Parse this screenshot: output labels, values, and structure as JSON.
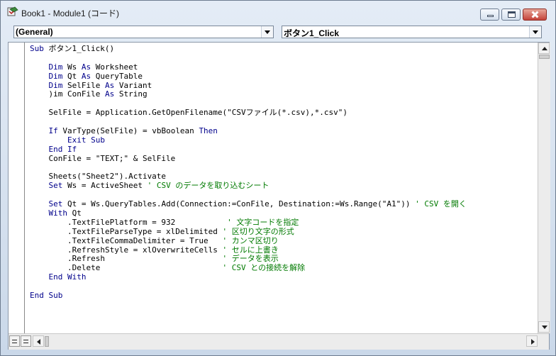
{
  "window": {
    "title": "Book1 - Module1 (コード)"
  },
  "combos": {
    "object_selected": "(General)",
    "procedure_selected": "ボタン1_Click"
  },
  "colors": {
    "keyword": "#00008b",
    "comment": "#007a00",
    "text": "#000000"
  },
  "code_lines": [
    [
      {
        "t": "kw",
        "v": "Sub"
      },
      {
        "t": "tx",
        "v": " ボタン1_Click()"
      }
    ],
    [],
    [
      {
        "t": "tx",
        "v": "    "
      },
      {
        "t": "kw",
        "v": "Dim"
      },
      {
        "t": "tx",
        "v": " Ws "
      },
      {
        "t": "kw",
        "v": "As"
      },
      {
        "t": "tx",
        "v": " Worksheet"
      }
    ],
    [
      {
        "t": "tx",
        "v": "    "
      },
      {
        "t": "kw",
        "v": "Dim"
      },
      {
        "t": "tx",
        "v": " Qt "
      },
      {
        "t": "kw",
        "v": "As"
      },
      {
        "t": "tx",
        "v": " QueryTable"
      }
    ],
    [
      {
        "t": "tx",
        "v": "    "
      },
      {
        "t": "kw",
        "v": "Dim"
      },
      {
        "t": "tx",
        "v": " SelFile "
      },
      {
        "t": "kw",
        "v": "As"
      },
      {
        "t": "tx",
        "v": " Variant"
      }
    ],
    [
      {
        "t": "tx",
        "v": "    )im ConFile "
      },
      {
        "t": "kw",
        "v": "As"
      },
      {
        "t": "tx",
        "v": " String"
      }
    ],
    [],
    [
      {
        "t": "tx",
        "v": "    SelFile = Application.GetOpenFilename(\"CSVファイル(*.csv),*.csv\")"
      }
    ],
    [],
    [
      {
        "t": "tx",
        "v": "    "
      },
      {
        "t": "kw",
        "v": "If"
      },
      {
        "t": "tx",
        "v": " VarType(SelFile) = vbBoolean "
      },
      {
        "t": "kw",
        "v": "Then"
      }
    ],
    [
      {
        "t": "tx",
        "v": "        "
      },
      {
        "t": "kw",
        "v": "Exit Sub"
      }
    ],
    [
      {
        "t": "tx",
        "v": "    "
      },
      {
        "t": "kw",
        "v": "End If"
      }
    ],
    [
      {
        "t": "tx",
        "v": "    ConFile = \"TEXT;\" & SelFile"
      }
    ],
    [],
    [
      {
        "t": "tx",
        "v": "    Sheets(\"Sheet2\").Activate"
      }
    ],
    [
      {
        "t": "tx",
        "v": "    "
      },
      {
        "t": "kw",
        "v": "Set"
      },
      {
        "t": "tx",
        "v": " Ws = ActiveSheet "
      },
      {
        "t": "cm",
        "v": "' CSV のデータを取り込むシート"
      }
    ],
    [],
    [
      {
        "t": "tx",
        "v": "    "
      },
      {
        "t": "kw",
        "v": "Set"
      },
      {
        "t": "tx",
        "v": " Qt = Ws.QueryTables.Add(Connection:=ConFile, Destination:=Ws.Range(\"A1\")) "
      },
      {
        "t": "cm",
        "v": "' CSV を開く"
      }
    ],
    [
      {
        "t": "tx",
        "v": "    "
      },
      {
        "t": "kw",
        "v": "With"
      },
      {
        "t": "tx",
        "v": " Qt"
      }
    ],
    [
      {
        "t": "tx",
        "v": "        .TextFilePlatform = 932           "
      },
      {
        "t": "cm",
        "v": "' 文字コードを指定"
      }
    ],
    [
      {
        "t": "tx",
        "v": "        .TextFileParseType = xlDelimited "
      },
      {
        "t": "cm",
        "v": "' 区切り文字の形式"
      }
    ],
    [
      {
        "t": "tx",
        "v": "        .TextFileCommaDelimiter = True   "
      },
      {
        "t": "cm",
        "v": "' カンマ区切り"
      }
    ],
    [
      {
        "t": "tx",
        "v": "        .RefreshStyle = xlOverwriteCells "
      },
      {
        "t": "cm",
        "v": "' セルに上書き"
      }
    ],
    [
      {
        "t": "tx",
        "v": "        .Refresh                         "
      },
      {
        "t": "cm",
        "v": "' データを表示"
      }
    ],
    [
      {
        "t": "tx",
        "v": "        .Delete                          "
      },
      {
        "t": "cm",
        "v": "' CSV との接続を解除"
      }
    ],
    [
      {
        "t": "tx",
        "v": "    "
      },
      {
        "t": "kw",
        "v": "End With"
      }
    ],
    [],
    [
      {
        "t": "kw",
        "v": "End Sub"
      }
    ]
  ],
  "icons": {
    "app": "vba-editor-icon",
    "minimize": "minimize-icon",
    "maximize": "maximize-icon",
    "close": "close-icon",
    "dropdown": "chevron-down-icon",
    "procedure_view": "procedure-view-icon",
    "full_module_view": "full-module-view-icon"
  }
}
